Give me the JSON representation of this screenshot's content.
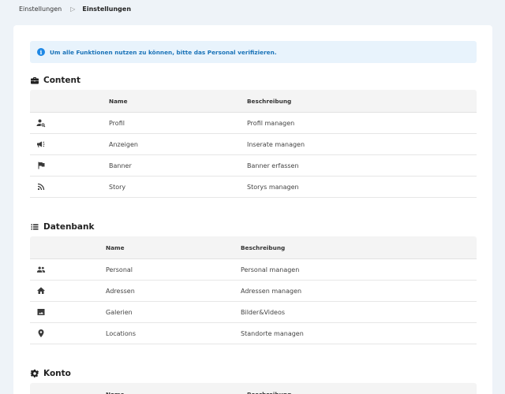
{
  "breadcrumb": {
    "parent": "Einstellungen",
    "separator": "▷",
    "current": "Einstellungen"
  },
  "notice": {
    "icon": "info-icon",
    "text": "Um alle Funktionen nutzen zu können, bitte das Personal verifizieren."
  },
  "sections": [
    {
      "title": "Content",
      "icon": "briefcase-icon",
      "columns": {
        "name": "Name",
        "description": "Beschreibung"
      },
      "rows": [
        {
          "icon": "user-search-icon",
          "name": "Profil",
          "description": "Profil managen"
        },
        {
          "icon": "megaphone-icon",
          "name": "Anzeigen",
          "description": "Inserate managen"
        },
        {
          "icon": "flag-icon",
          "name": "Banner",
          "description": "Banner erfassen"
        },
        {
          "icon": "rss-icon",
          "name": "Story",
          "description": "Storys managen"
        }
      ]
    },
    {
      "title": "Datenbank",
      "icon": "list-icon",
      "columns": {
        "name": "Name",
        "description": "Beschreibung"
      },
      "rows": [
        {
          "icon": "people-icon",
          "name": "Personal",
          "description": "Personal managen"
        },
        {
          "icon": "home-icon",
          "name": "Adressen",
          "description": "Adressen managen"
        },
        {
          "icon": "image-icon",
          "name": "Galerien",
          "description": "Bilder&Videos"
        },
        {
          "icon": "location-pin-icon",
          "name": "Locations",
          "description": "Standorte managen"
        }
      ]
    },
    {
      "title": "Konto",
      "icon": "gear-icon",
      "columns": {
        "name": "Name",
        "description": "Beschreibung"
      },
      "rows": []
    }
  ],
  "colors": {
    "background": "#eef3f8",
    "notice_bg": "#e8f3fc",
    "notice_text": "#1a73b8",
    "info_icon": "#1e88e5",
    "icon": "#3a3a3a"
  }
}
